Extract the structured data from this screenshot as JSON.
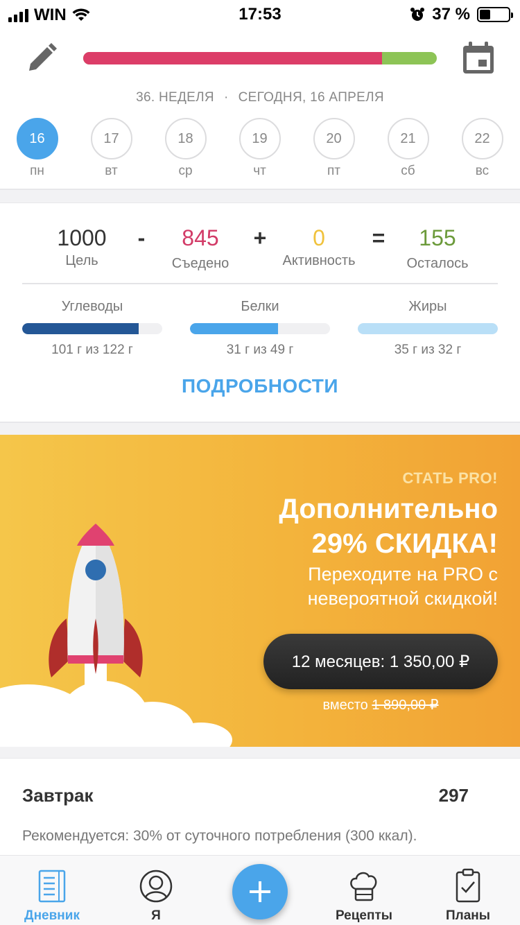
{
  "status_bar": {
    "carrier": "WIN",
    "time": "17:53",
    "battery": "37 %",
    "battery_level": 0.37
  },
  "header": {
    "progress_eaten_fraction": 0.845,
    "week_label": "36. НЕДЕЛЯ",
    "date_label": "СЕГОДНЯ, 16 АПРЕЛЯ",
    "days": [
      {
        "num": "16",
        "label": "пн",
        "active": true
      },
      {
        "num": "17",
        "label": "вт"
      },
      {
        "num": "18",
        "label": "ср"
      },
      {
        "num": "19",
        "label": "чт"
      },
      {
        "num": "20",
        "label": "пт"
      },
      {
        "num": "21",
        "label": "сб"
      },
      {
        "num": "22",
        "label": "вс"
      }
    ]
  },
  "summary": {
    "goal": {
      "value": "1000",
      "label": "Цель"
    },
    "minus": "-",
    "eaten": {
      "value": "845",
      "label": "Съедено"
    },
    "plus": "+",
    "activity": {
      "value": "0",
      "label": "Активность"
    },
    "equals": "=",
    "remaining": {
      "value": "155",
      "label": "Осталось"
    },
    "macros": [
      {
        "name": "Углеводы",
        "amount": "101 г из 122 г",
        "fraction": 0.83,
        "color": "#245796"
      },
      {
        "name": "Белки",
        "amount": "31 г из 49 г",
        "fraction": 0.63,
        "color": "#4aa5ea"
      },
      {
        "name": "Жиры",
        "amount": "35 г из 32 г",
        "fraction": 1.0,
        "color": "#b9dff7"
      }
    ],
    "details_label": "ПОДРОБНОСТИ"
  },
  "colors": {
    "accent": "#4aa5ea",
    "eaten": "#d23b67",
    "activity": "#f0c23c",
    "remaining": "#6b9a3a",
    "progress_red": "#dc3d68",
    "progress_green": "#8dc456"
  },
  "promo": {
    "kicker": "СТАТЬ PRO!",
    "title_line1": "Дополнительно",
    "title_line2": "29% СКИДКА!",
    "subtitle": "Переходите на PRO с невероятной скидкой!",
    "button_label": "12 месяцев: 1 350,00 ₽",
    "instead_label": "вместо",
    "old_price": "1 890,00 ₽"
  },
  "meal": {
    "name": "Завтрак",
    "kcal": "297",
    "recommendation": "Рекомендуется: 30% от суточного потребления (300 ккал)."
  },
  "tabbar": {
    "tabs": [
      {
        "label": "Дневник",
        "icon": "diary-icon",
        "active": true
      },
      {
        "label": "Я",
        "icon": "profile-icon"
      },
      {
        "label": "Рецепты",
        "icon": "chef-hat-icon"
      },
      {
        "label": "Планы",
        "icon": "clipboard-check-icon"
      }
    ],
    "add_button": "+"
  }
}
